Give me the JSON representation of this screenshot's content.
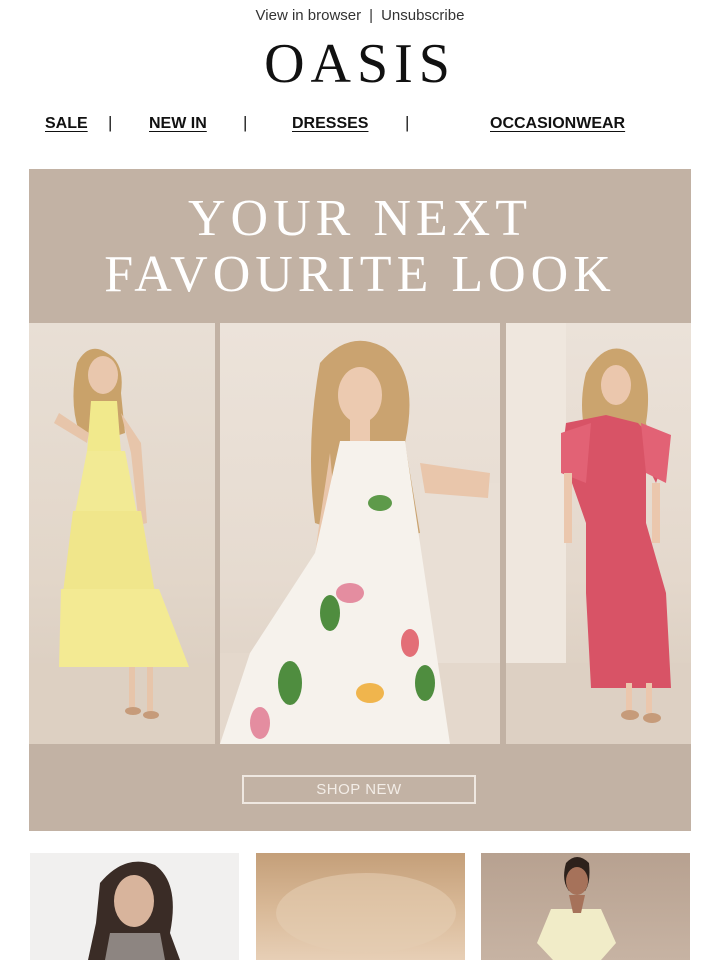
{
  "header": {
    "view_in_browser": "View in browser",
    "separator": "|",
    "unsubscribe": "Unsubscribe"
  },
  "brand": {
    "logo_text": "OASIS"
  },
  "nav": {
    "items": [
      {
        "label": "SALE"
      },
      {
        "label": "NEW IN"
      },
      {
        "label": "DRESSES"
      },
      {
        "label": "OCCASIONWEAR"
      }
    ],
    "divider": "|"
  },
  "hero": {
    "title_line1": "YOUR NEXT",
    "title_line2": "FAVOURITE LOOK",
    "cta_label": "SHOP NEW",
    "background_color": "#c2b2a4",
    "images": [
      {
        "name": "model-yellow-tiered-dress"
      },
      {
        "name": "model-white-floral-dress"
      },
      {
        "name": "model-pink-ruffle-dress"
      }
    ]
  },
  "product_tiles": [
    {
      "name": "model-grey-knit-top"
    },
    {
      "name": "blurred-neutral-image"
    },
    {
      "name": "model-cream-dress"
    }
  ]
}
